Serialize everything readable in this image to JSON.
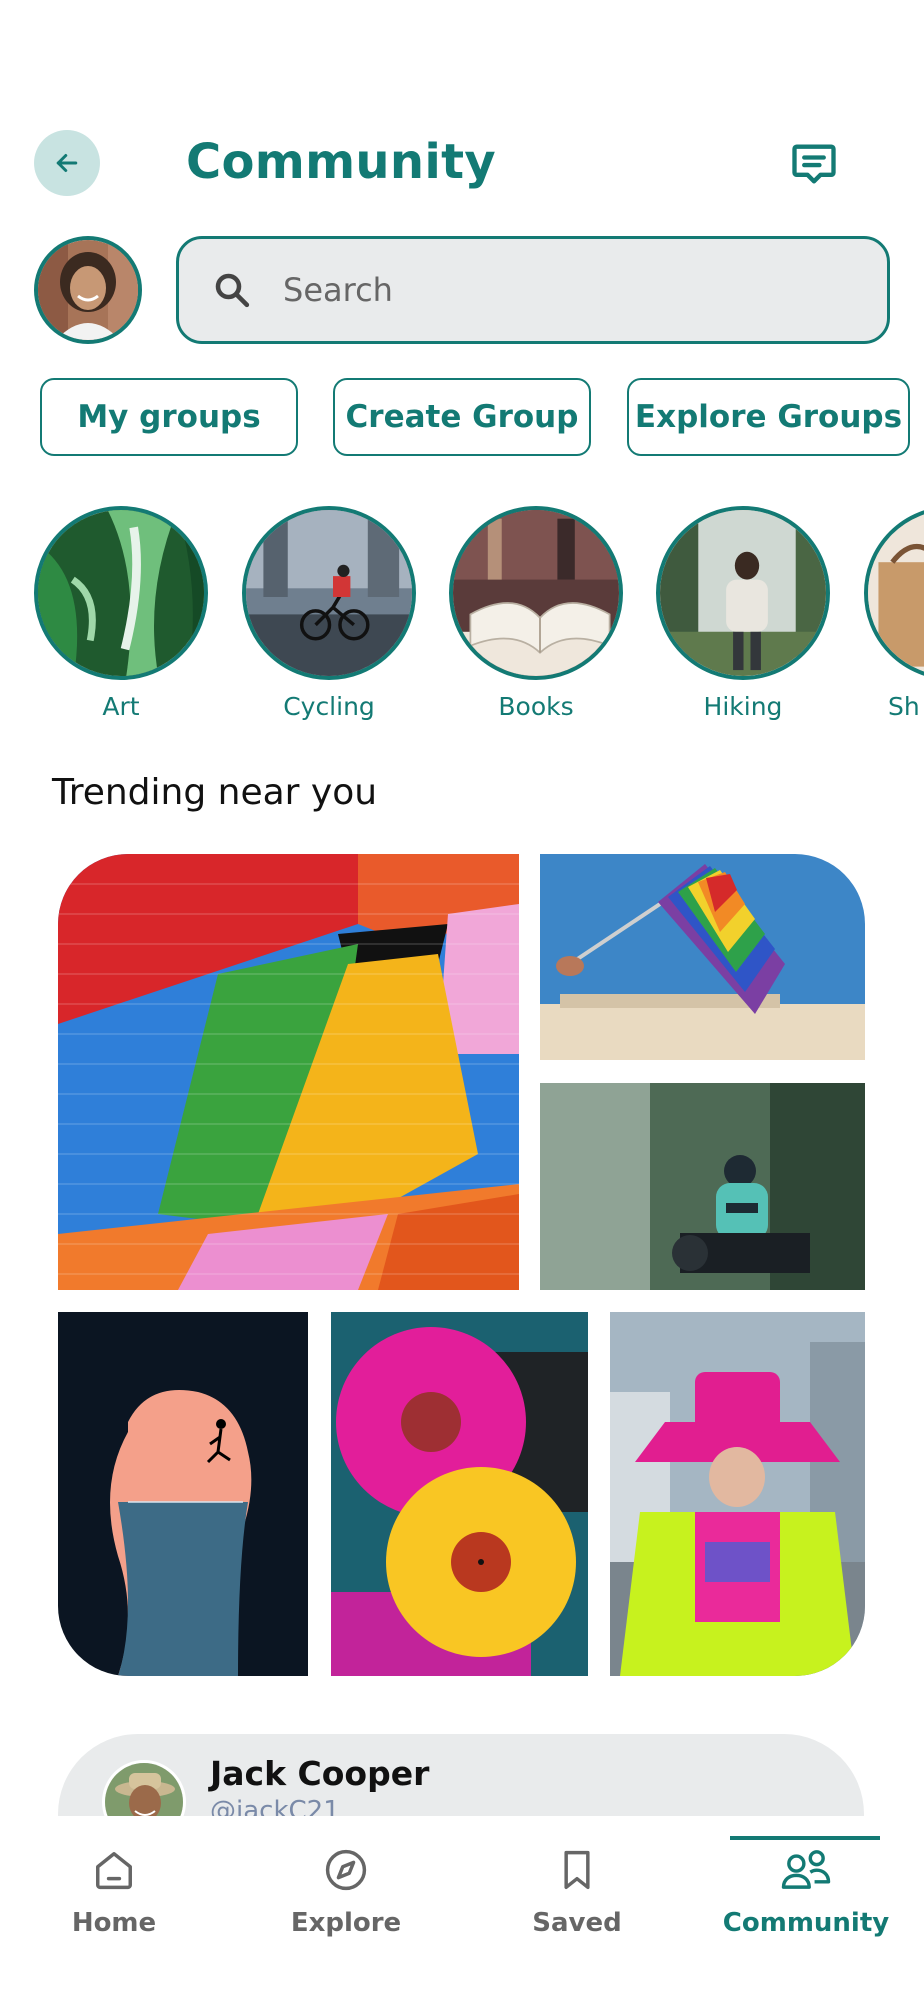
{
  "header": {
    "title": "Community",
    "back_icon": "arrow-left-icon",
    "message_icon": "message-icon"
  },
  "search": {
    "placeholder": "Search",
    "icon": "search-icon"
  },
  "group_buttons": [
    {
      "label": "My groups"
    },
    {
      "label": "Create Group"
    },
    {
      "label": "Explore Groups"
    }
  ],
  "categories": [
    {
      "label": "Art"
    },
    {
      "label": "Cycling"
    },
    {
      "label": "Books"
    },
    {
      "label": "Hiking"
    },
    {
      "label": "Sh"
    }
  ],
  "trending": {
    "title": "Trending near you"
  },
  "post": {
    "name": "Jack Cooper",
    "handle": "@jackC21"
  },
  "nav": {
    "items": [
      {
        "label": "Home",
        "icon": "home-icon"
      },
      {
        "label": "Explore",
        "icon": "compass-icon"
      },
      {
        "label": "Saved",
        "icon": "bookmark-icon"
      },
      {
        "label": "Community",
        "icon": "people-icon"
      }
    ],
    "active": "Community"
  },
  "colors": {
    "accent": "#137a74",
    "accent_light": "#c8e3e1",
    "surface": "#e9ebec"
  }
}
